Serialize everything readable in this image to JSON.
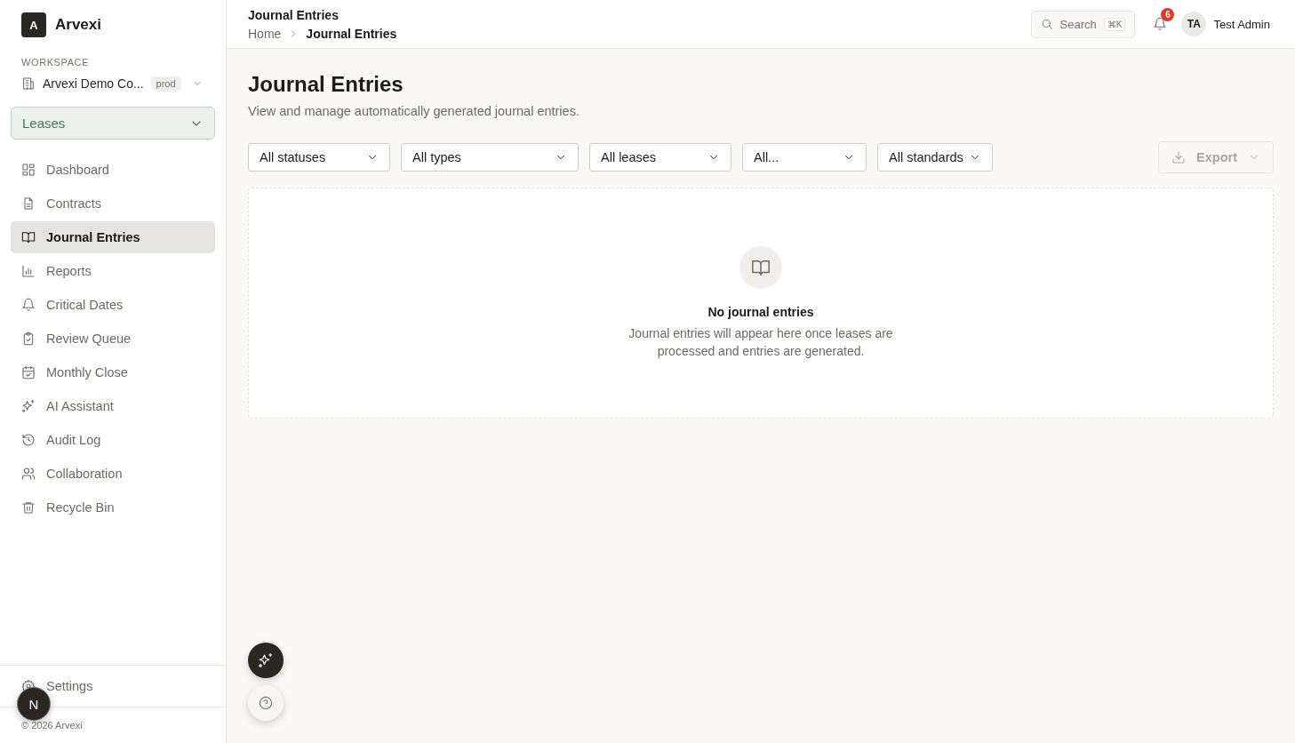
{
  "brand": {
    "logo": "A",
    "name": "Arvexi"
  },
  "workspace": {
    "label": "WORKSPACE",
    "name": "Arvexi Demo Co...",
    "badge": "prod"
  },
  "module": {
    "label": "Leases"
  },
  "nav": [
    {
      "label": "Dashboard",
      "selected": false
    },
    {
      "label": "Contracts",
      "selected": false
    },
    {
      "label": "Journal Entries",
      "selected": true
    },
    {
      "label": "Reports",
      "selected": false
    },
    {
      "label": "Critical Dates",
      "selected": false
    },
    {
      "label": "Review Queue",
      "selected": false
    },
    {
      "label": "Monthly Close",
      "selected": false
    },
    {
      "label": "AI Assistant",
      "selected": false
    },
    {
      "label": "Audit Log",
      "selected": false
    },
    {
      "label": "Collaboration",
      "selected": false
    },
    {
      "label": "Recycle Bin",
      "selected": false
    }
  ],
  "settings": {
    "label": "Settings"
  },
  "footer": "© 2026 Arvexi",
  "header": {
    "title": "Journal Entries",
    "breadcrumb": [
      "Home",
      "Journal Entries"
    ],
    "search": {
      "placeholder": "Search",
      "shortcut": "⌘K"
    },
    "notifications": "6",
    "user": {
      "initials": "TA",
      "name": "Test Admin"
    }
  },
  "page": {
    "title": "Journal Entries",
    "subtitle": "View and manage automatically generated journal entries."
  },
  "filters": [
    {
      "label": "All statuses"
    },
    {
      "label": "All types"
    },
    {
      "label": "All leases"
    },
    {
      "label": "All..."
    },
    {
      "label": "All standards"
    }
  ],
  "export": {
    "label": "Export",
    "disabled": true
  },
  "empty": {
    "title": "No journal entries",
    "message": "Journal entries will appear here once leases are processed and entries are generated."
  },
  "floating": {
    "badge": "N"
  }
}
